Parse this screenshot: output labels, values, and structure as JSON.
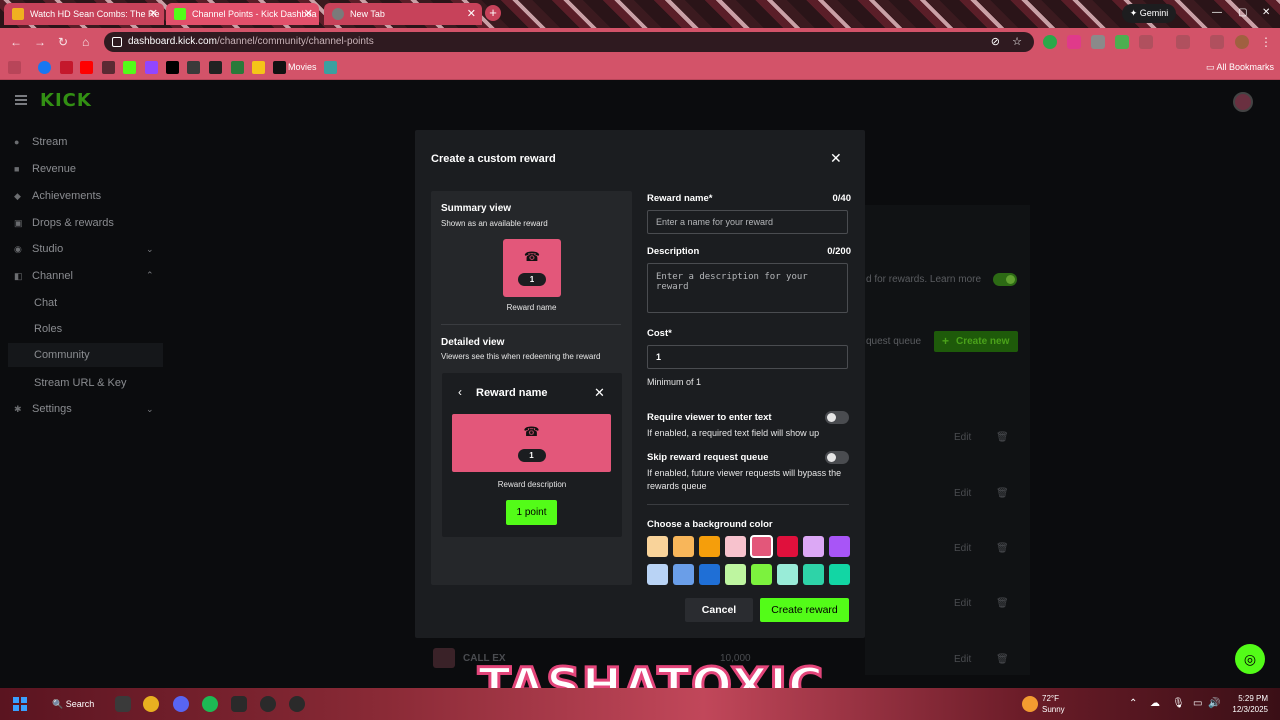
{
  "browser": {
    "tabs": [
      {
        "label": "Watch HD Sean Combs: The Re",
        "active": false
      },
      {
        "label": "Channel Points - Kick Dashboa",
        "active": true
      },
      {
        "label": "New Tab",
        "active": false
      }
    ],
    "gemini_label": "Gemini",
    "url_host": "dashboard.kick.com",
    "url_path": "/channel/community/channel-points",
    "bookmarks_movies": "Movies",
    "all_bookmarks": "All Bookmarks"
  },
  "sidebar": {
    "logo": "KICK",
    "items": [
      {
        "label": "Stream",
        "icon": "play-icon"
      },
      {
        "label": "Revenue",
        "icon": "chart-icon"
      },
      {
        "label": "Achievements",
        "icon": "trophy-icon"
      },
      {
        "label": "Drops & rewards",
        "icon": "gift-icon"
      },
      {
        "label": "Studio",
        "icon": "studio-icon"
      },
      {
        "label": "Channel",
        "icon": "channel-icon"
      }
    ],
    "channel_sub": [
      "Chat",
      "Roles",
      "Community",
      "Stream URL & Key"
    ],
    "settings": "Settings",
    "active_sub": "Community"
  },
  "background": {
    "rewards_hint": "d for rewards. Learn more",
    "request_queue": "quest queue",
    "create_new": "Create new",
    "edit": "Edit",
    "row_label": "CALL EX",
    "row_value": "10,000"
  },
  "modal": {
    "title": "Create a custom reward",
    "summary_title": "Summary view",
    "summary_sub": "Shown as an available reward",
    "summary_cost": "1",
    "summary_name": "Reward name",
    "detail_title": "Detailed view",
    "detail_sub": "Viewers see this when redeeming the reward",
    "detail_name": "Reward name",
    "detail_cost": "1",
    "detail_desc": "Reward description",
    "detail_point": "1 point",
    "reward_name_label": "Reward name*",
    "reward_name_count": "0/40",
    "reward_name_placeholder": "Enter a name for your reward",
    "description_label": "Description",
    "description_count": "0/200",
    "description_placeholder": "Enter a description for your reward",
    "cost_label": "Cost*",
    "cost_value": "1",
    "cost_hint": "Minimum of 1",
    "require_text_label": "Require viewer to enter text",
    "require_text_hint": "If enabled, a required text field will show up",
    "skip_queue_label": "Skip reward request queue",
    "skip_queue_hint": "If enabled, future viewer requests will bypass the rewards queue",
    "color_label": "Choose a background color",
    "colors": [
      "#f9d39a",
      "#f8b65a",
      "#f59e0b",
      "#f7c2cd",
      "#e3577a",
      "#e0103c",
      "#dca8f5",
      "#a855f7",
      "#b9d3f5",
      "#6a9ee8",
      "#1f6fd6",
      "#bef5a0",
      "#7cf23e",
      "#99ecd8",
      "#2ed3a8",
      "#12d6a4"
    ],
    "selected_color": "#e3577a",
    "cancel": "Cancel",
    "create": "Create reward"
  },
  "taskbar": {
    "search": "Search",
    "temp": "72°F",
    "weather": "Sunny",
    "time": "5:29 PM",
    "date": "12/3/2025"
  },
  "overlay_text": "TASHATOXIC"
}
